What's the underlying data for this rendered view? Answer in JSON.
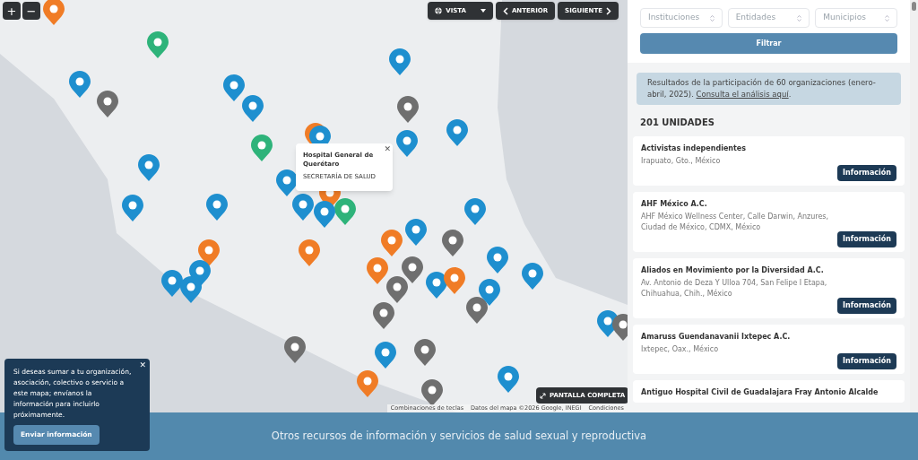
{
  "map": {
    "zoom_in": "+",
    "zoom_out": "−",
    "view_button": "VISTA",
    "prev_button": "ANTERIOR",
    "next_button": "SIGUIENTE",
    "fullscreen_button": "PANTALLA COMPLETA",
    "attribution": [
      "Combinaciones de teclas",
      "Datos del mapa ©2026 Google, INEGI",
      "Condiciones"
    ],
    "popup": {
      "title": "Hospital General de Querétaro",
      "subtitle": "SECRETARÍA DE SALUD",
      "close": "✕"
    },
    "pins": [
      {
        "color": "#f07c26"
      },
      {
        "color": "#2eb37a"
      },
      {
        "color": "#1e8fcf"
      },
      {
        "color": "#6f6f6f"
      },
      {
        "color": "#1e8fcf"
      },
      {
        "color": "#1e8fcf"
      },
      {
        "color": "#1e8fcf"
      },
      {
        "color": "#6f6f6f"
      },
      {
        "color": "#1e8fcf"
      },
      {
        "color": "#f07c26"
      },
      {
        "color": "#1e8fcf"
      },
      {
        "color": "#1e8fcf"
      },
      {
        "color": "#2eb37a"
      },
      {
        "color": "#1e8fcf"
      },
      {
        "color": "#1e8fcf"
      },
      {
        "color": "#1e8fcf"
      },
      {
        "color": "#f07c26"
      },
      {
        "color": "#1e8fcf"
      },
      {
        "color": "#2eb37a"
      },
      {
        "color": "#1e8fcf"
      },
      {
        "color": "#f07c26"
      },
      {
        "color": "#1e8fcf"
      },
      {
        "color": "#6f6f6f"
      },
      {
        "color": "#f07c26"
      },
      {
        "color": "#f07c26"
      },
      {
        "color": "#1e8fcf"
      },
      {
        "color": "#1e8fcf"
      },
      {
        "color": "#f07c26"
      },
      {
        "color": "#6f6f6f"
      },
      {
        "color": "#1e8fcf"
      },
      {
        "color": "#6f6f6f"
      },
      {
        "color": "#1e8fcf"
      },
      {
        "color": "#1e8fcf"
      },
      {
        "color": "#6f6f6f"
      },
      {
        "color": "#6f6f6f"
      },
      {
        "color": "#1e8fcf"
      },
      {
        "color": "#1e8fcf"
      },
      {
        "color": "#1e8fcf"
      },
      {
        "color": "#6f6f6f"
      },
      {
        "color": "#1e8fcf"
      },
      {
        "color": "#6f6f6f"
      },
      {
        "color": "#f07c26"
      },
      {
        "color": "#f07c26"
      },
      {
        "color": "#1e8fcf"
      },
      {
        "color": "#6f6f6f"
      },
      {
        "color": "#1e8fcf"
      },
      {
        "color": "#1e8fcf"
      },
      {
        "color": "#6f6f6f"
      }
    ]
  },
  "filters": {
    "selects": [
      {
        "placeholder": "Instituciones"
      },
      {
        "placeholder": "Entidades"
      },
      {
        "placeholder": "Municipios"
      }
    ],
    "button": "Filtrar"
  },
  "notice": {
    "text": "Resultados de la participación de 60 organizaciones (enero-abril, 2025).",
    "link": "Consulta el análisis aquí",
    "after": "."
  },
  "count": "201 UNIDADES",
  "units": [
    {
      "name": "Activistas independientes",
      "address": "Irapuato, Gto., México",
      "button": "Información"
    },
    {
      "name": "AHF México A.C.",
      "address": "AHF México Wellness Center, Calle Darwin, Anzures, Ciudad de México, CDMX, México",
      "button": "Información"
    },
    {
      "name": "Aliados en Movimiento por la Diversidad A.C.",
      "address": "Av. Antonio de Deza Y Ulloa 704, San Felipe I Etapa, Chihuahua, Chih., México",
      "button": "Información"
    },
    {
      "name": "Amaruss Guendanavanii Ixtepec A.C.",
      "address": "Ixtepec, Oax., México",
      "button": "Información"
    },
    {
      "name": "Antiguo Hospital Civil de Guadalajara Fray Antonio Alcalde"
    }
  ],
  "callout": {
    "text": "Si deseas sumar a tu organización, asociación, colectivo o servicio a este mapa; envíanos la información para incluirlo próximamente.",
    "close": "✕",
    "button": "Enviar información"
  },
  "footer": {
    "text": "Otros recursos de información y servicios de salud sexual y reproductiva"
  }
}
